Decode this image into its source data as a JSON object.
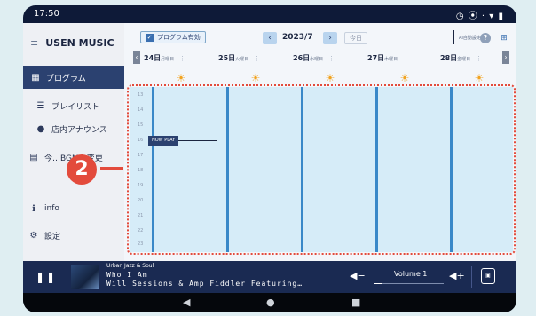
{
  "status_bar": {
    "time": "17:50",
    "icons": "◷ ⦿ · ▾ ▮"
  },
  "sidebar": {
    "menu_icon": "≡",
    "brand": "USEN MUSIC",
    "items": [
      {
        "icon": "▦",
        "label": "プログラム",
        "active": true
      },
      {
        "icon": "☰",
        "label": "プレイリスト",
        "active": false
      },
      {
        "icon": "●",
        "label": "店内アナウンス",
        "active": false
      },
      {
        "icon": "▤",
        "label": "今…BGMを変更",
        "active": false
      },
      {
        "icon": "ℹ",
        "label": "info",
        "active": false
      },
      {
        "icon": "⚙",
        "label": "設定",
        "active": false
      }
    ]
  },
  "toolbar": {
    "program_toggle_label": "プログラム有効",
    "checkmark": "✓",
    "prev": "‹",
    "month": "2023/7",
    "next": "›",
    "today": "今日",
    "ai_label": "AI自動設定",
    "help": "?",
    "layout_icon": "⊞"
  },
  "dates": {
    "prev": "‹",
    "next": "›",
    "days": [
      {
        "day": "24日",
        "weekday": "月曜日",
        "weather": "☀"
      },
      {
        "day": "25日",
        "weekday": "火曜日",
        "weather": "☀"
      },
      {
        "day": "26日",
        "weekday": "水曜日",
        "weather": "☀"
      },
      {
        "day": "27日",
        "weekday": "木曜日",
        "weather": "☀"
      },
      {
        "day": "28日",
        "weekday": "金曜日",
        "weather": "☀"
      }
    ],
    "more_icon": "⋮"
  },
  "schedule": {
    "hours": [
      "13",
      "14",
      "15",
      "16",
      "17",
      "18",
      "19",
      "20",
      "21",
      "22",
      "23"
    ],
    "now_label": "NOW PLAY"
  },
  "callout": {
    "number": "2"
  },
  "player": {
    "pause_icon": "❚❚",
    "genre": "Urban Jazz & Soul",
    "title": "Who I Am",
    "artist": "Will Sessions & Amp Fiddler Featuring…",
    "volume_label": "Volume 1",
    "volume_level": 0.1,
    "vol_down_icon": "◀−",
    "vol_up_icon": "◀+",
    "radio_icon": "▣"
  },
  "android_nav": {
    "back": "◀",
    "home": "●",
    "recents": "■"
  },
  "colors": {
    "navy": "#1a2a52",
    "accent_blue": "#3a88c8",
    "highlight_red": "#e34b3c",
    "sun_orange": "#f2a31f"
  }
}
